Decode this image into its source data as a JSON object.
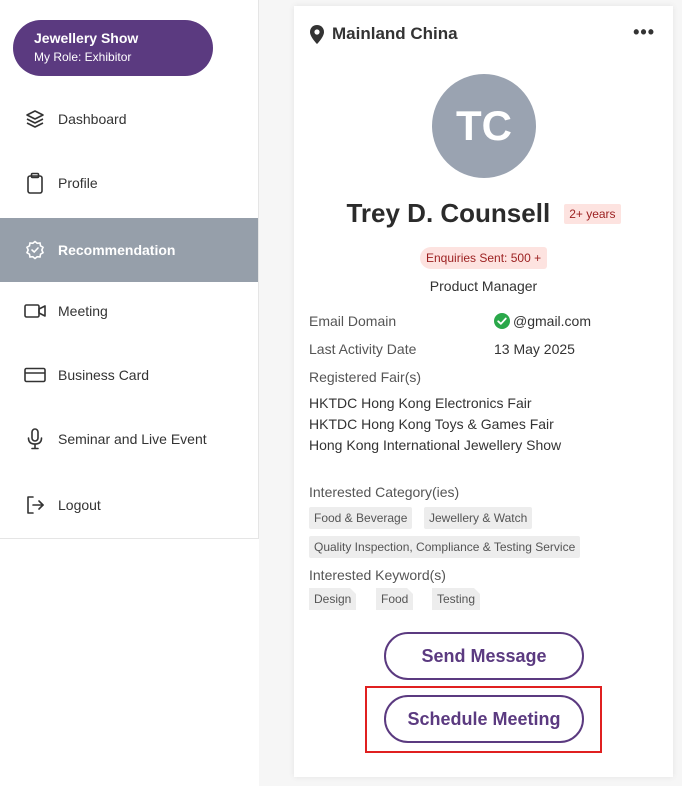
{
  "sidebar": {
    "event_name": "Jewellery Show",
    "role_text": "My Role: Exhibitor",
    "items": [
      {
        "label": "Dashboard",
        "icon": "layers-icon"
      },
      {
        "label": "Profile",
        "icon": "clipboard-icon"
      },
      {
        "label": "Recommendation",
        "icon": "gear-badge-icon",
        "active": true
      },
      {
        "label": "Meeting",
        "icon": "video-camera-icon"
      },
      {
        "label": "Business Card",
        "icon": "credit-card-icon"
      },
      {
        "label": "Seminar and Live Event",
        "icon": "microphone-icon"
      },
      {
        "label": "Logout",
        "icon": "logout-icon"
      }
    ]
  },
  "card": {
    "location": "Mainland China",
    "more_label": "•••",
    "initials": "TC",
    "name": "Trey D. Counsell",
    "years_badge": "2+ years",
    "enquiries": "Enquiries Sent: 500 +",
    "job_title": "Product Manager",
    "email_domain_label": "Email Domain",
    "email_domain_value": "@gmail.com",
    "last_activity_label": "Last Activity Date",
    "last_activity_value": "13 May 2025",
    "registered_fairs_label": "Registered Fair(s)",
    "fairs": [
      "HKTDC Hong Kong Electronics Fair",
      "HKTDC Hong Kong Toys & Games Fair",
      "Hong Kong International Jewellery Show"
    ],
    "interested_category_label": "Interested Category(ies)",
    "categories": [
      "Food & Beverage",
      "Jewellery & Watch",
      "Quality Inspection, Compliance & Testing Service"
    ],
    "interested_keyword_label": "Interested Keyword(s)",
    "keywords": [
      "Design",
      "Food",
      "Testing"
    ],
    "send_message_label": "Send Message",
    "schedule_meeting_label": "Schedule Meeting"
  },
  "colors": {
    "brand": "#5b3a80",
    "active_nav": "#969faa",
    "badge_bg": "#fde3e0",
    "badge_text": "#9b1f1f",
    "verified": "#2aa84a",
    "highlight": "#e02020"
  }
}
